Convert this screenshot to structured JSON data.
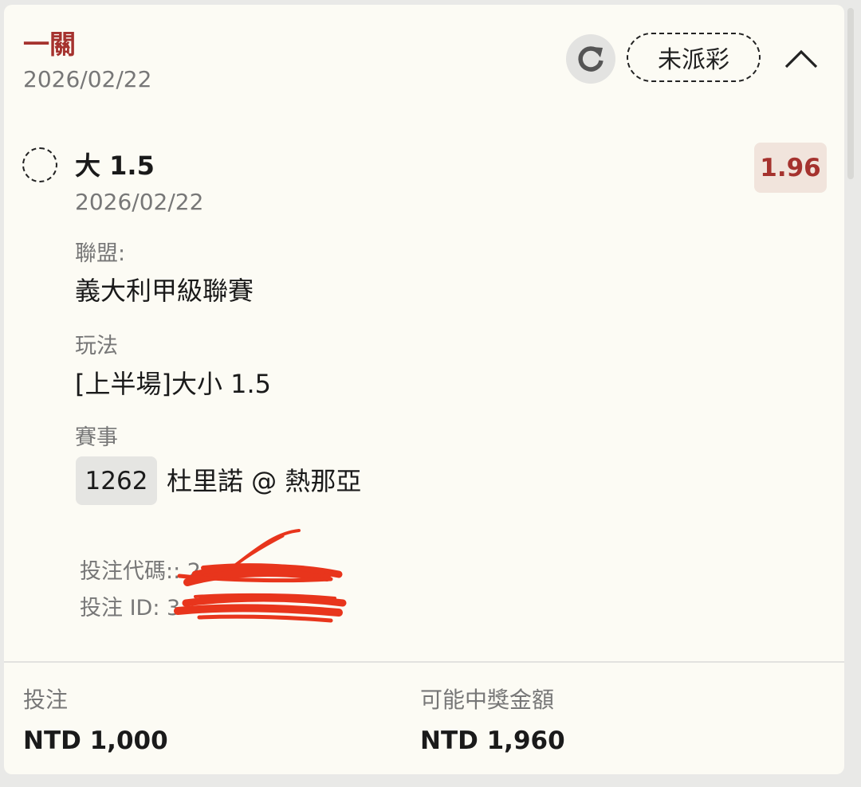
{
  "header": {
    "bet_type": "一關",
    "date": "2026/02/22",
    "status": "未派彩",
    "refresh_icon": "refresh-icon",
    "collapse_icon": "chevron-up-icon"
  },
  "selection": {
    "name": "大 1.5",
    "date": "2026/02/22",
    "odds": "1.96",
    "status_icon": "pending-circle-icon"
  },
  "details": {
    "league_label": "聯盟:",
    "league_value": "義大利甲級聯賽",
    "market_label": "玩法",
    "market_value": "[上半場]大小 1.5",
    "event_label": "賽事",
    "event_id": "1262",
    "event_name": "杜里諾 @ 熱那亞"
  },
  "codes": {
    "bet_code": "投注代碼:: 2",
    "bet_id": "投注 ID: 3"
  },
  "footer": {
    "stake_label": "投注",
    "stake_value": "NTD 1,000",
    "payout_label": "可能中獎金額",
    "payout_value": "NTD 1,960"
  },
  "colors": {
    "accent": "#a5322e",
    "odds_bg": "#f1e4dc",
    "card_bg": "#fcfbf4",
    "page_bg": "#e9e9e7",
    "redaction": "#e8351c"
  }
}
